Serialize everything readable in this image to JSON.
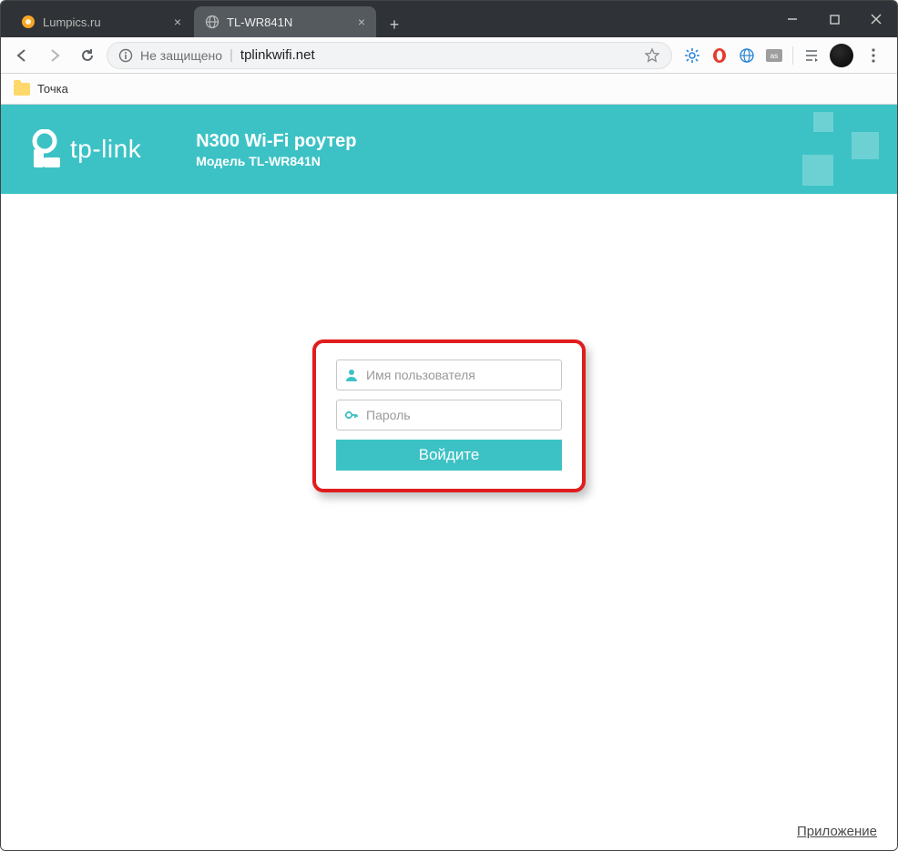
{
  "window": {
    "tabs": [
      {
        "label": "Lumpics.ru",
        "active": false
      },
      {
        "label": "TL-WR841N",
        "active": true
      }
    ]
  },
  "address": {
    "security_label": "Не защищено",
    "url": "tplinkwifi.net"
  },
  "bookmarks": {
    "items": [
      {
        "label": "Точка"
      }
    ]
  },
  "banner": {
    "brand": "tp-link",
    "title": "N300 Wi-Fi роутер",
    "model_prefix": "Модель",
    "model_value": "TL-WR841N"
  },
  "login": {
    "username_placeholder": "Имя пользователя",
    "password_placeholder": "Пароль",
    "submit_label": "Войдите"
  },
  "footer": {
    "app_link": "Приложение"
  }
}
